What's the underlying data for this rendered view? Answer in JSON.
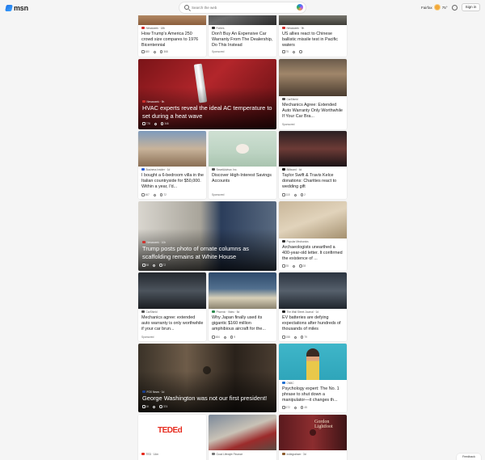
{
  "header": {
    "logo_text": "msn",
    "search_placeholder": "Search the web",
    "weather": {
      "location": "Fairfax",
      "temp": "75°"
    },
    "signin_label": "Sign in"
  },
  "cards": [
    {
      "id": "c1",
      "source": "Newsweek · 18h",
      "title": "How Trump's America 250 crowd size compares to 1976 Bicentennial",
      "likes": "480",
      "comments": "368",
      "src_color": "#d0312d"
    },
    {
      "id": "c2",
      "source": "Forbes",
      "title": "Don't Buy An Expensive Car Warranty From The Dealership, Do This Instead",
      "sponsored": "Sponsored",
      "src_color": "#333333"
    },
    {
      "id": "c3",
      "source": "Newsweek · 9h",
      "title": "US allies react to Chinese ballistic missile test in Pacific waters",
      "likes": "75",
      "comments": "",
      "src_color": "#d0312d"
    },
    {
      "id": "c4",
      "source": "Newsweek · 9h",
      "title": "HVAC experts reveal the ideal AC temperature to set during a heat wave",
      "likes": "778",
      "comments": "346",
      "src_color": "#d0312d",
      "hero": true
    },
    {
      "id": "c5",
      "source": "CarShield",
      "title": "Mechanics Agree: Extended Auto Warranty Only Worthwhile If Your Car Bra...",
      "sponsored": "Sponsored",
      "src_color": "#555555"
    },
    {
      "id": "c6",
      "source": "Business Insider · 1d",
      "title": "I bought a 6-bedroom villa in the Italian countryside for $50,000. Within a year, I'd...",
      "likes": "467",
      "comments": "72",
      "src_color": "#2c5fd4"
    },
    {
      "id": "c7",
      "source": "SmartAdvisor, Inc.",
      "title": "Discover High-Interest Savings Accounts",
      "sponsored": "Sponsored",
      "src_color": "#555555"
    },
    {
      "id": "c8",
      "source": "Billboard · 4d",
      "title": "Taylor Swift & Travis Kelce donations: Charities react to wedding gift",
      "likes": "115",
      "comments": "2",
      "src_color": "#111111"
    },
    {
      "id": "c9",
      "source": "Newsweek · 10h",
      "title": "Trump posts photo of ornate columns as scaffolding remains at White House",
      "likes": "58",
      "comments": "72",
      "src_color": "#d0312d",
      "hero": true
    },
    {
      "id": "c10",
      "source": "Popular Mechanics",
      "title": "Archaeologists unearthed a 400-year-old letter. It confirmed the existence of ...",
      "likes": "35",
      "comments": "28",
      "src_color": "#333333"
    },
    {
      "id": "c11",
      "source": "CarShield",
      "title": "Mechanics agree: extended auto warranty is only worthwhile if your car brun...",
      "sponsored": "Sponsored",
      "src_color": "#555555"
    },
    {
      "id": "c12",
      "source": "Phoenix · Video · 5d",
      "title": "Why Japan finally used its gigantic $160 million amphibious aircraft for the...",
      "likes": "484",
      "comments": "9",
      "src_color": "#2d8a4e"
    },
    {
      "id": "c13",
      "source": "The Wall Street Journal · 1d",
      "title": "EV batteries are defying expectations after hundreds of thousands of miles",
      "likes": "158",
      "comments": "79",
      "src_color": "#222222"
    },
    {
      "id": "c14",
      "source": "FOX News · 1d",
      "title": "George Washington was not our first president!",
      "likes": "1K",
      "comments": "374",
      "src_color": "#1a3e8c",
      "hero": true
    },
    {
      "id": "c15",
      "source": "CNBC",
      "title": "Psychology expert: The No. 1 phrase to shut down a manipulator—it changes th...",
      "likes": "672",
      "comments": "45",
      "src_color": "#1f6fd1"
    },
    {
      "id": "c16",
      "source": "TED · 14m",
      "title": "",
      "src_color": "#e62b1e"
    },
    {
      "id": "c17",
      "source": "Good Lifestyle Finance",
      "title": "",
      "src_color": "#777777"
    },
    {
      "id": "c18",
      "source": "Indiegraham · 3d",
      "title": "",
      "src_color": "#8a5a2b"
    }
  ],
  "ted_logo": "TEDEd",
  "gordon_text": "Gordon\nLightfoot",
  "feedback_label": "Feedback"
}
